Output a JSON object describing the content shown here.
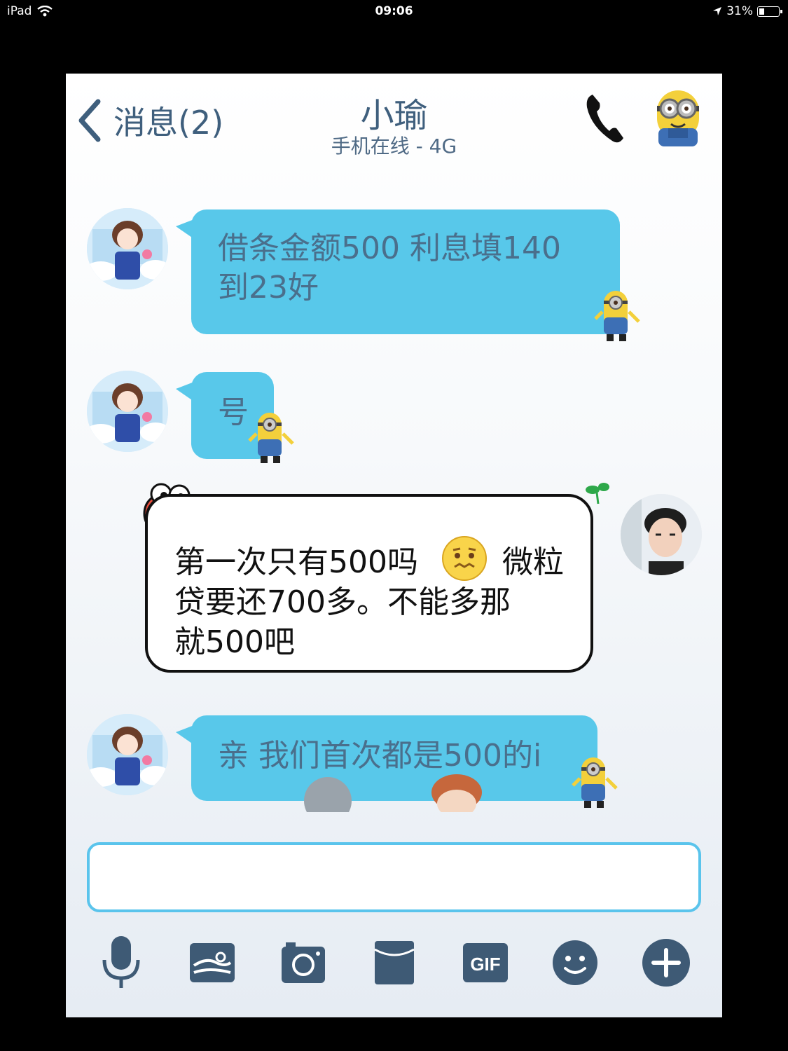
{
  "status_bar": {
    "device": "iPad",
    "time": "09:06",
    "battery": "31%",
    "battery_level": 0.31
  },
  "header": {
    "back_label": "消息(2)",
    "contact_name": "小瑜",
    "contact_status": "手机在线 - 4G"
  },
  "messages": [
    {
      "side": "left",
      "text_lines": [
        "借条金额500 利息填140",
        "到23好"
      ]
    },
    {
      "side": "left",
      "text_lines": [
        "号"
      ]
    },
    {
      "side": "right",
      "text_lines": [
        "第一次只有500吗",
        "微粒",
        "贷要还700多。不能多那",
        "就500吧"
      ]
    },
    {
      "side": "left",
      "text_lines": [
        "亲 我们首次都是500的i"
      ]
    }
  ],
  "input": {
    "value": ""
  },
  "toolbar": {
    "gif_label": "GIF",
    "icons": [
      "microphone-icon",
      "photo-icon",
      "camera-icon",
      "red-packet-icon",
      "gif-icon",
      "emoji-icon",
      "plus-icon"
    ]
  },
  "colors": {
    "bubble": "#58c8ea",
    "header_text": "#3f5f7d",
    "toolbar_icon": "#3e5a75",
    "input_border": "#5ac4ec"
  }
}
